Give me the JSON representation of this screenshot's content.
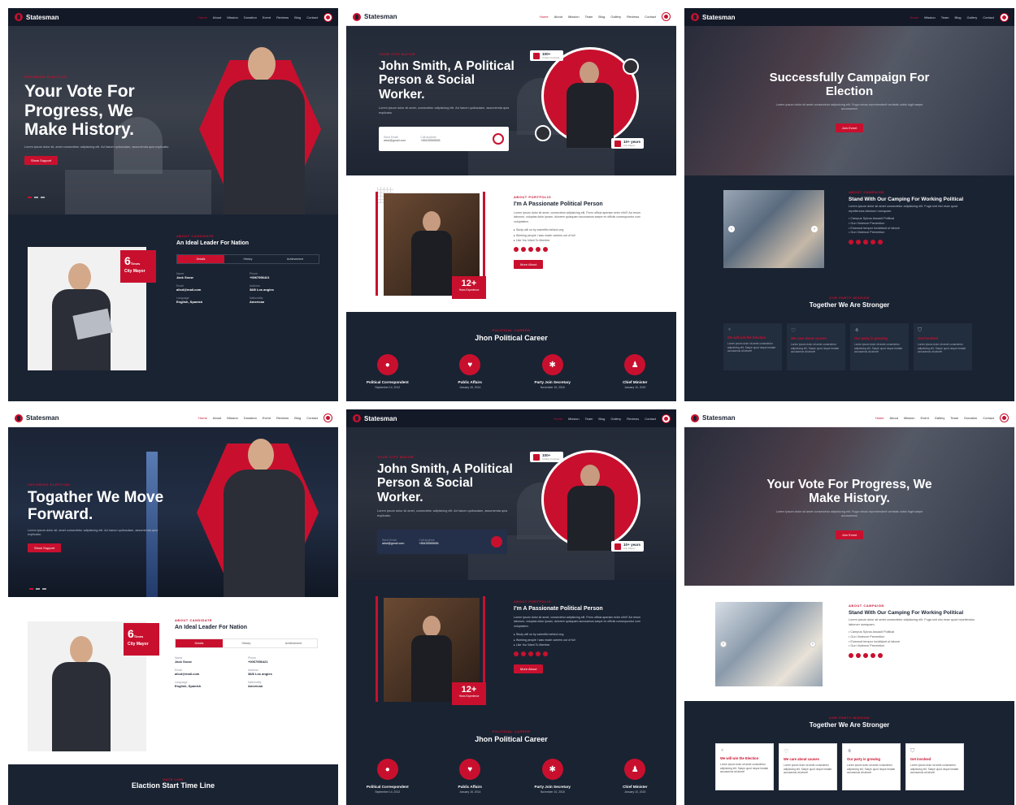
{
  "brand": "Statesman",
  "nav_v1": [
    "Home",
    "About",
    "Mission",
    "Donation",
    "Event",
    "Reviews",
    "Blog",
    "Contact"
  ],
  "nav_v2": [
    "Home",
    "About",
    "Mission",
    "Team",
    "Blog",
    "Gallery",
    "Reviews",
    "Contact"
  ],
  "nav_v3": [
    "Home",
    "Mission",
    "Team",
    "Blog",
    "Gallery",
    "Contact"
  ],
  "nav_v6": [
    "Home",
    "About",
    "Mission",
    "Event",
    "Gallery",
    "Team",
    "Donation",
    "Contact"
  ],
  "p1": {
    "tag": "Upcoming Election",
    "title": "Your Vote For Progress, We Make History.",
    "text": "Lorem ipsum dolor sit, amet consectetur adipisicing elit. Ad harum quibusdam, assumenda quia explicabo.",
    "button": "Show Support",
    "about_tag": "About Candidate",
    "about_title": "An Ideal Leader For Nation",
    "badge_num": "6",
    "badge_sup": "Times",
    "badge_text": "City Mayor",
    "tabs": [
      "Details",
      "History",
      "Achievement"
    ],
    "fields": [
      {
        "label": "Name",
        "value": "Jack Snow"
      },
      {
        "label": "Phone",
        "value": "+0067956421"
      },
      {
        "label": "Email",
        "value": "alicd@mail.com"
      },
      {
        "label": "Address",
        "value": "38/8 Los angles"
      },
      {
        "label": "Language",
        "value": "English, Spanish"
      },
      {
        "label": "Nationality",
        "value": "American"
      }
    ]
  },
  "p2": {
    "tag": "Your City Mayor",
    "title": "John Smith, A Political Person & Social Worker.",
    "text": "Lorem ipsum dolor sit amet, consectetur adipisicing elit. Ad harum quibusdam, assumenda quia explicabo.",
    "send_label": "Send Email",
    "send_value": "alicd@gmail.com",
    "call_label": "Call anytime",
    "call_value": "+88435565656",
    "charity_num": "100+",
    "charity_text": "Charity Founder",
    "years_num": "10+ years",
    "years_text": "City Mayor",
    "about_tag": "About Portfolio",
    "about_title": "I'm A Passionate Political Person",
    "about_text": "Lorem ipsum dolor sit amet, consectetur adipisicing elit. Porro officia aperiam enim nihil? Ad rerum laborum, voluptas dolor ipsam, dolorem quisquam accusamus saepe ex officiis consequuntur cum voluptatem.",
    "list": [
      "Study will on by scientific behind ong",
      "Working people I was made careers out of full",
      "Like You Want To Member"
    ],
    "exp_num": "12+",
    "exp_text": "Years Experience",
    "button": "More About",
    "career_tag": "Political Career",
    "career_title": "Jhon Political Career",
    "careers": [
      {
        "name": "Political Correspondent",
        "date": "September 14, 2012"
      },
      {
        "name": "Public Affairs",
        "date": "January 15, 2014"
      },
      {
        "name": "Party Join Secretary",
        "date": "November 10, 2018"
      },
      {
        "name": "Chief Minister",
        "date": "January 10, 2020"
      }
    ]
  },
  "p3": {
    "title": "Successfully Campaign For Election",
    "text": "Lorem ipsum dolor sit amet consectetur adipisicing elit. Fuga minus reprehenderit veritatis nobis fugit saepe accusamus!",
    "button": "Join Event",
    "about_tag": "About Campaign",
    "about_title": "Stand With Our Camping For Working Political",
    "about_text": "Lorem ipsum dolor sit amet consectetur adipisicing elit. Fuga sint nisi esse quod repellendus laborum numquam.",
    "list": [
      "Campus Sylvus Assault Political",
      "Gun Violence Prevention",
      "Eiusmod tempor incididunt ut labore",
      "Gun Violence Prevention"
    ],
    "mission_tag": "Our Party Mission",
    "mission_title": "Together We Are Stronger",
    "missions": [
      {
        "title": "We will win the Election",
        "text": "Lorem ipsum dolor sit amet consectetur adipisicing elit. Saepe quod neque beatae accusamus at labore!"
      },
      {
        "title": "We care about causes",
        "text": "Lorem ipsum dolor sit amet consectetur adipisicing elit. Saepe quod neque beatae accusamus at labore!"
      },
      {
        "title": "Our party is growing",
        "text": "Lorem ipsum dolor sit amet consectetur adipisicing elit. Saepe quod neque beatae accusamus at labore!"
      },
      {
        "title": "Get involved",
        "text": "Lorem ipsum dolor sit amet consectetur adipisicing elit. Saepe quod neque beatae accusamus at labore!"
      }
    ]
  },
  "p4": {
    "tag": "Upcoming Election",
    "title": "Togather We Move Forward.",
    "text": "Lorem ipsum dolor sit, amet consectetur adipisicing elit. Ad harum quibusdam, assumenda quia explicabo.",
    "button": "Show Support",
    "about_tag": "About Candidate",
    "about_title": "An Ideal Leader For Nation",
    "timeline_tag": "Date Line",
    "timeline_title": "Elaction Start Time Line"
  },
  "p5": {
    "tag": "Your City Mayor",
    "title": "John Smith, A Political Person & Social Worker."
  },
  "p6": {
    "title": "Your Vote For Progress, We Make History.",
    "about_title": "Stand With Our Camping For Working Political"
  }
}
